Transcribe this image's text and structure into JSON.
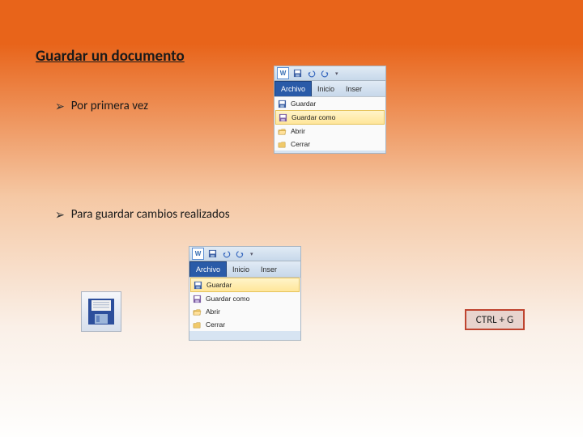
{
  "title": "Guardar un documento",
  "bullets": {
    "first": "Por primera vez",
    "second": "Para guardar cambios realizados"
  },
  "shortcut": "CTRL + G",
  "word_menu": {
    "tab_active": "Archivo",
    "tab_home": "Inicio",
    "tab_insert": "Inser",
    "items": {
      "save": "Guardar",
      "save_as": "Guardar como",
      "open": "Abrir",
      "close": "Cerrar"
    }
  }
}
